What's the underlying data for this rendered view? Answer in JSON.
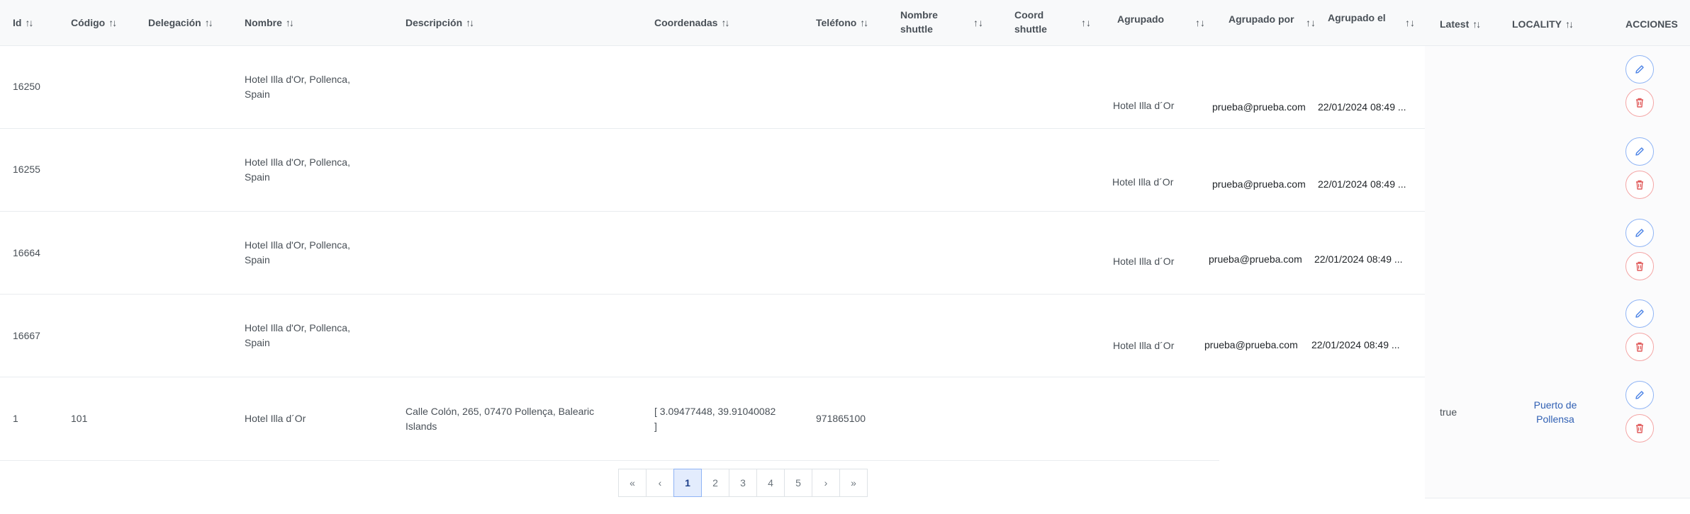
{
  "table": {
    "columns": {
      "id": "Id",
      "codigo": "Código",
      "delegacion": "Delegación",
      "nombre": "Nombre",
      "descripcion": "Descripción",
      "coordenadas": "Coordenadas",
      "telefono": "Teléfono",
      "nombre_shuttle_1": "Nombre",
      "nombre_shuttle_2": "shuttle",
      "coord_shuttle_1": "Coord",
      "coord_shuttle_2": "shuttle",
      "agrupado": "Agrupado",
      "agrupado_por": "Agrupado por",
      "agrupado_el": "Agrupado el",
      "latest": "Latest",
      "locality": "LOCALITY",
      "acciones": "ACCIONES"
    },
    "sort_icon": "↑↓",
    "rows": [
      {
        "id": "16250",
        "codigo": "",
        "delegacion": "",
        "nombre_1": "Hotel Illa d'Or, Pollenca,",
        "nombre_2": "Spain",
        "descripcion_1": "",
        "descripcion_2": "",
        "coordenadas_1": "",
        "coordenadas_2": "",
        "telefono": "",
        "nombre_shuttle": "",
        "coord_shuttle": "",
        "agrupado": "Hotel Illa d´Or",
        "agrupado_por": "prueba@prueba.com",
        "agrupado_el": "22/01/2024 08:49 ...",
        "latest": "",
        "locality_1": "",
        "locality_2": ""
      },
      {
        "id": "16255",
        "codigo": "",
        "delegacion": "",
        "nombre_1": "Hotel Illa d'Or, Pollenca,",
        "nombre_2": "Spain",
        "descripcion_1": "",
        "descripcion_2": "",
        "coordenadas_1": "",
        "coordenadas_2": "",
        "telefono": "",
        "nombre_shuttle": "",
        "coord_shuttle": "",
        "agrupado": "Hotel Illa d´Or",
        "agrupado_por": "prueba@prueba.com",
        "agrupado_el": "22/01/2024 08:49 ...",
        "latest": "",
        "locality_1": "",
        "locality_2": ""
      },
      {
        "id": "16664",
        "codigo": "",
        "delegacion": "",
        "nombre_1": "Hotel Illa d'Or, Pollenca,",
        "nombre_2": "Spain",
        "descripcion_1": "",
        "descripcion_2": "",
        "coordenadas_1": "",
        "coordenadas_2": "",
        "telefono": "",
        "nombre_shuttle": "",
        "coord_shuttle": "",
        "agrupado": "Hotel Illa d´Or",
        "agrupado_por": "prueba@prueba.com",
        "agrupado_el": "22/01/2024 08:49 ...",
        "latest": "",
        "locality_1": "",
        "locality_2": ""
      },
      {
        "id": "16667",
        "codigo": "",
        "delegacion": "",
        "nombre_1": "Hotel Illa d'Or, Pollenca,",
        "nombre_2": "Spain",
        "descripcion_1": "",
        "descripcion_2": "",
        "coordenadas_1": "",
        "coordenadas_2": "",
        "telefono": "",
        "nombre_shuttle": "",
        "coord_shuttle": "",
        "agrupado": "Hotel Illa d´Or",
        "agrupado_por": "prueba@prueba.com",
        "agrupado_el": "22/01/2024 08:49 ...",
        "latest": "",
        "locality_1": "",
        "locality_2": ""
      },
      {
        "id": "1",
        "codigo": "101",
        "delegacion": "",
        "nombre_1": "Hotel Illa d´Or",
        "nombre_2": "",
        "descripcion_1": "Calle Colón, 265, 07470 Pollença, Balearic",
        "descripcion_2": "Islands",
        "coordenadas_1": "[ 3.09477448, 39.91040082",
        "coordenadas_2": "]",
        "telefono": "971865100",
        "nombre_shuttle": "",
        "coord_shuttle": "",
        "agrupado": "",
        "agrupado_por": "",
        "agrupado_el": "",
        "latest": "true",
        "locality_1": "Puerto de",
        "locality_2": "Pollensa"
      }
    ]
  },
  "actions": {
    "edit_icon": "pencil-icon",
    "delete_icon": "trash-icon"
  },
  "pagination": {
    "first": "«",
    "prev": "‹",
    "pages": [
      "1",
      "2",
      "3",
      "4",
      "5"
    ],
    "current": "1",
    "next": "›",
    "last": "»"
  },
  "colors": {
    "header_bg": "#f8f9fa",
    "edit_accent": "#8fb4f5",
    "delete_accent": "#f4a5a5",
    "locality_link": "#2f5fb3",
    "active_page_bg": "#e3ecfd"
  }
}
